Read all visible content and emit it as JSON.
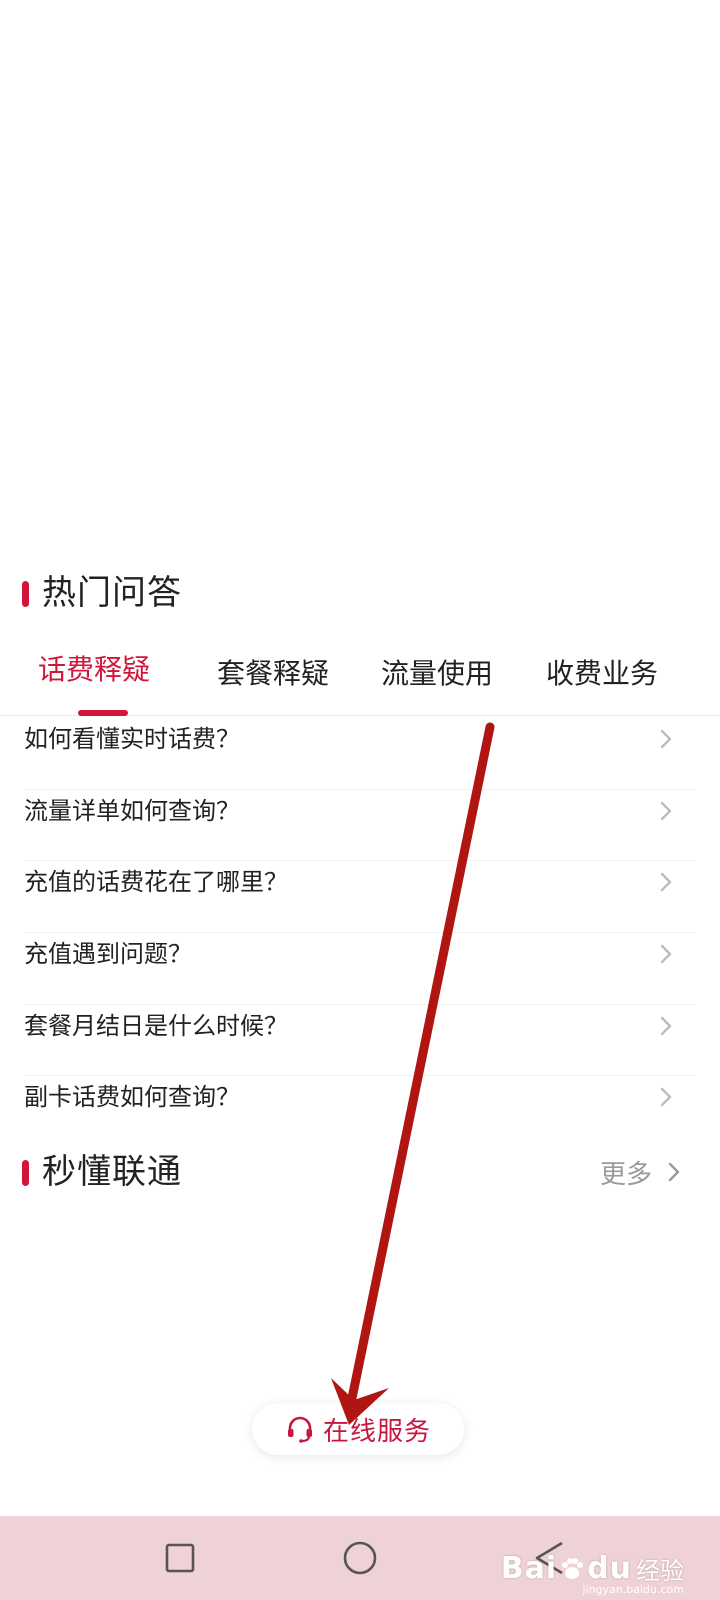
{
  "hot_qa": {
    "title": "热门问答",
    "tabs": [
      {
        "label": "话费释疑",
        "active": true
      },
      {
        "label": "套餐释疑",
        "active": false
      },
      {
        "label": "流量使用",
        "active": false
      },
      {
        "label": "收费业务",
        "active": false
      }
    ],
    "questions": [
      "如何看懂实时话费？",
      "流量详单如何查询？",
      "充值的话费花在了哪里？",
      "充值遇到问题？",
      "套餐月结日是什么时候？",
      "副卡话费如何查询？"
    ]
  },
  "miaodong": {
    "title": "秒懂联通",
    "more_label": "更多"
  },
  "online_service": {
    "label": "在线服务",
    "icon": "headset-icon"
  },
  "navbar": {
    "buttons": [
      "recent-apps",
      "home",
      "back"
    ]
  },
  "watermark": {
    "logo": "Bai",
    "logo_suffix": "du",
    "cn": "经验",
    "url": "jingyan.baidu.com"
  },
  "colors": {
    "accent": "#d1163a",
    "annotation_arrow": "#b01512",
    "navbar_bg": "#efd2d7",
    "muted_text": "#9a9a9a"
  }
}
